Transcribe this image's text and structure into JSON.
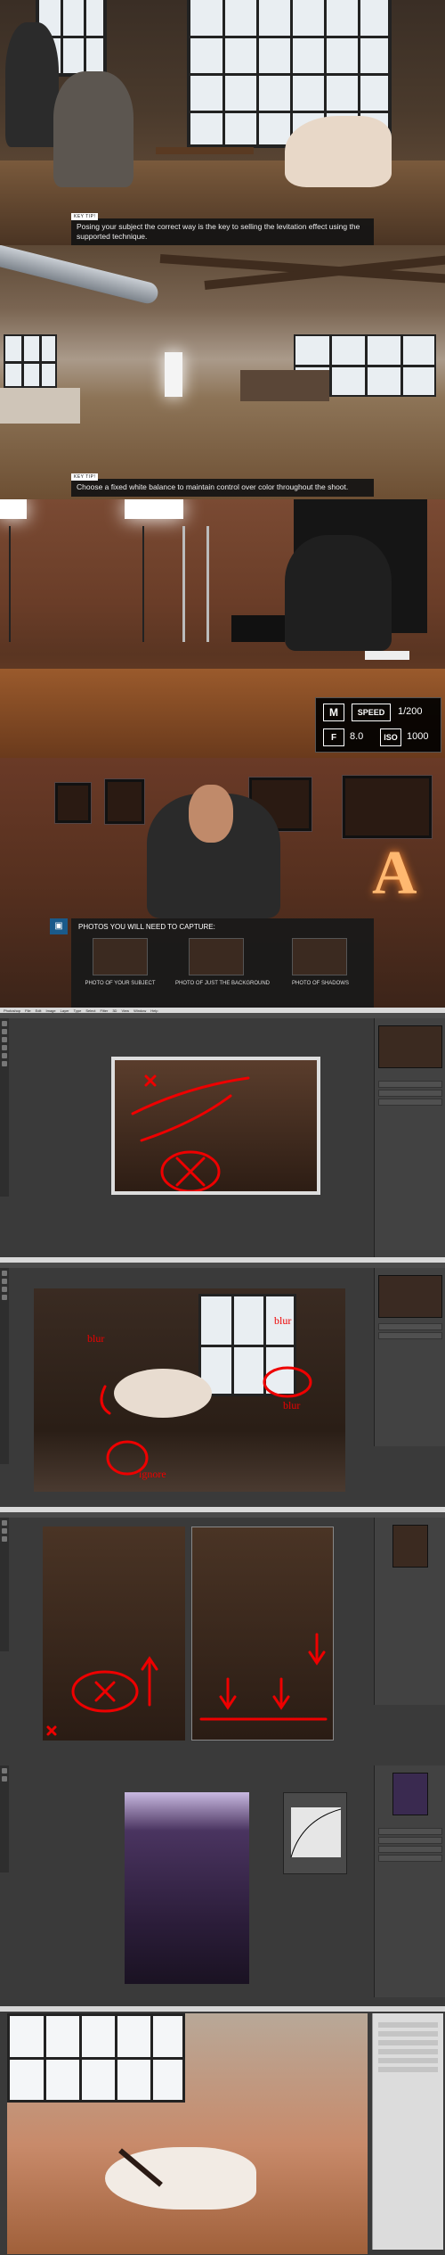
{
  "frames": {
    "key_tip_1": {
      "tag": "KEY TIP!",
      "text": "Posing your subject the correct way is the key to selling the levitation effect using the supported technique."
    },
    "key_tip_2": {
      "tag": "KEY TIP!",
      "text": "Choose a fixed white balance to maintain control over color throughout the shoot."
    },
    "camera_settings": {
      "mode": "M",
      "speed_label": "SPEED",
      "speed_value": "1/200",
      "aperture_label": "F",
      "aperture_value": "8.0",
      "iso_label": "ISO",
      "iso_value": "1000"
    },
    "capture_panel": {
      "title": "PHOTOS YOU WILL NEED TO CAPTURE:",
      "items": [
        "PHOTO OF YOUR SUBJECT",
        "PHOTO OF JUST THE BACKGROUND",
        "PHOTO OF SHADOWS"
      ],
      "marquee_letter": "A"
    },
    "photoshop": {
      "menu_items": [
        "Photoshop",
        "File",
        "Edit",
        "Image",
        "Layer",
        "Type",
        "Select",
        "Filter",
        "3D",
        "View",
        "Window",
        "Help"
      ],
      "annotations": [
        "blur",
        "blur",
        "blur",
        "ignore"
      ]
    }
  },
  "colors": {
    "accent_red": "#e00000",
    "keytip_bg": "#141414",
    "panel_bg": "#424242"
  }
}
